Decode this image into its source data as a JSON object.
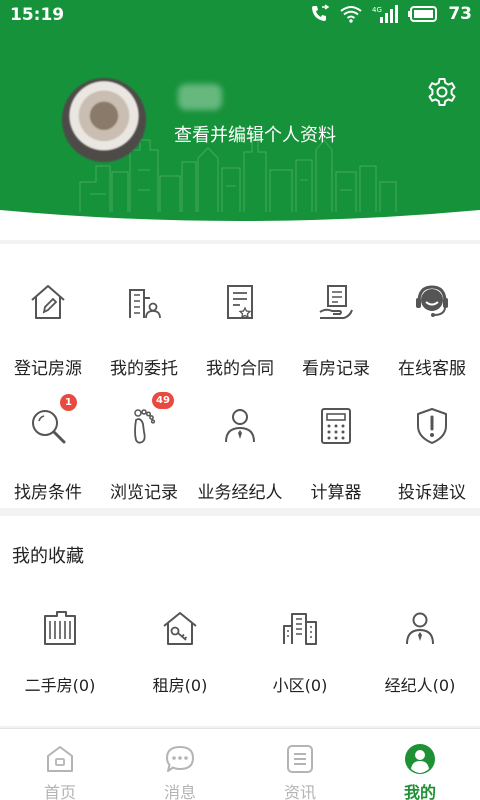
{
  "status_bar": {
    "time": "15:19",
    "battery": "73",
    "network": "4G"
  },
  "colors": {
    "brand_green": "#16923a",
    "badge_red": "#e84a3f",
    "icon_gray": "#555555",
    "nav_inactive": "#b4b4b4"
  },
  "header": {
    "profile_link": "查看并编辑个人资料"
  },
  "menu": [
    {
      "label": "登记房源",
      "icon": "house-edit-icon"
    },
    {
      "label": "我的委托",
      "icon": "building-person-icon"
    },
    {
      "label": "我的合同",
      "icon": "contract-icon"
    },
    {
      "label": "看房记录",
      "icon": "hand-document-icon"
    },
    {
      "label": "在线客服",
      "icon": "headset-icon"
    },
    {
      "label": "找房条件",
      "icon": "magnifier-icon",
      "badge": "1"
    },
    {
      "label": "浏览记录",
      "icon": "footprint-icon",
      "badge": "49"
    },
    {
      "label": "业务经纪人",
      "icon": "agent-icon"
    },
    {
      "label": "计算器",
      "icon": "calculator-icon"
    },
    {
      "label": "投诉建议",
      "icon": "shield-alert-icon"
    }
  ],
  "favorites": {
    "title": "我的收藏",
    "items": [
      {
        "label": "二手房(0)",
        "icon": "building-icon"
      },
      {
        "label": "租房(0)",
        "icon": "house-key-icon"
      },
      {
        "label": "小区(0)",
        "icon": "city-icon"
      },
      {
        "label": "经纪人(0)",
        "icon": "agent-icon"
      }
    ]
  },
  "bottom_nav": [
    {
      "label": "首页",
      "icon": "home-icon",
      "active": false
    },
    {
      "label": "消息",
      "icon": "message-icon",
      "active": false
    },
    {
      "label": "资讯",
      "icon": "news-icon",
      "active": false
    },
    {
      "label": "我的",
      "icon": "profile-icon",
      "active": true
    }
  ]
}
